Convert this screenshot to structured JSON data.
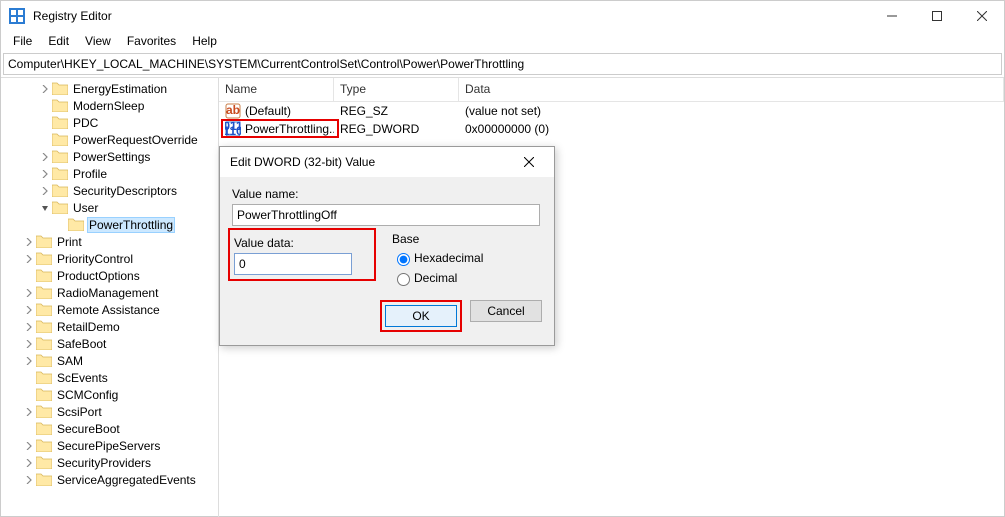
{
  "window": {
    "title": "Registry Editor",
    "min": "–",
    "max": "▢",
    "close": "✕"
  },
  "menu": [
    "File",
    "Edit",
    "View",
    "Favorites",
    "Help"
  ],
  "address": "Computer\\HKEY_LOCAL_MACHINE\\SYSTEM\\CurrentControlSet\\Control\\Power\\PowerThrottling",
  "tree": [
    {
      "depth": 2,
      "exp": ">",
      "label": "EnergyEstimation"
    },
    {
      "depth": 2,
      "exp": "",
      "label": "ModernSleep"
    },
    {
      "depth": 2,
      "exp": "",
      "label": "PDC"
    },
    {
      "depth": 2,
      "exp": "",
      "label": "PowerRequestOverride"
    },
    {
      "depth": 2,
      "exp": ">",
      "label": "PowerSettings"
    },
    {
      "depth": 2,
      "exp": ">",
      "label": "Profile"
    },
    {
      "depth": 2,
      "exp": ">",
      "label": "SecurityDescriptors"
    },
    {
      "depth": 2,
      "exp": "v",
      "label": "User"
    },
    {
      "depth": 3,
      "exp": "",
      "label": "PowerThrottling",
      "selected": true
    },
    {
      "depth": 1,
      "exp": ">",
      "label": "Print"
    },
    {
      "depth": 1,
      "exp": ">",
      "label": "PriorityControl"
    },
    {
      "depth": 1,
      "exp": "",
      "label": "ProductOptions"
    },
    {
      "depth": 1,
      "exp": ">",
      "label": "RadioManagement"
    },
    {
      "depth": 1,
      "exp": ">",
      "label": "Remote Assistance"
    },
    {
      "depth": 1,
      "exp": ">",
      "label": "RetailDemo"
    },
    {
      "depth": 1,
      "exp": ">",
      "label": "SafeBoot"
    },
    {
      "depth": 1,
      "exp": ">",
      "label": "SAM"
    },
    {
      "depth": 1,
      "exp": "",
      "label": "ScEvents"
    },
    {
      "depth": 1,
      "exp": "",
      "label": "SCMConfig"
    },
    {
      "depth": 1,
      "exp": ">",
      "label": "ScsiPort"
    },
    {
      "depth": 1,
      "exp": "",
      "label": "SecureBoot"
    },
    {
      "depth": 1,
      "exp": ">",
      "label": "SecurePipeServers"
    },
    {
      "depth": 1,
      "exp": ">",
      "label": "SecurityProviders"
    },
    {
      "depth": 1,
      "exp": ">",
      "label": "ServiceAggregatedEvents"
    }
  ],
  "list": {
    "headers": {
      "name": "Name",
      "type": "Type",
      "data": "Data"
    },
    "rows": [
      {
        "icon": "sz",
        "name": "(Default)",
        "type": "REG_SZ",
        "data": "(value not set)"
      },
      {
        "icon": "dw",
        "name": "PowerThrottling...",
        "type": "REG_DWORD",
        "data": "0x00000000 (0)",
        "highlight": true
      }
    ]
  },
  "dialog": {
    "title": "Edit DWORD (32-bit) Value",
    "valueNameLabel": "Value name:",
    "valueName": "PowerThrottlingOff",
    "valueDataLabel": "Value data:",
    "valueData": "0",
    "baseLabel": "Base",
    "hex": "Hexadecimal",
    "dec": "Decimal",
    "ok": "OK",
    "cancel": "Cancel"
  }
}
